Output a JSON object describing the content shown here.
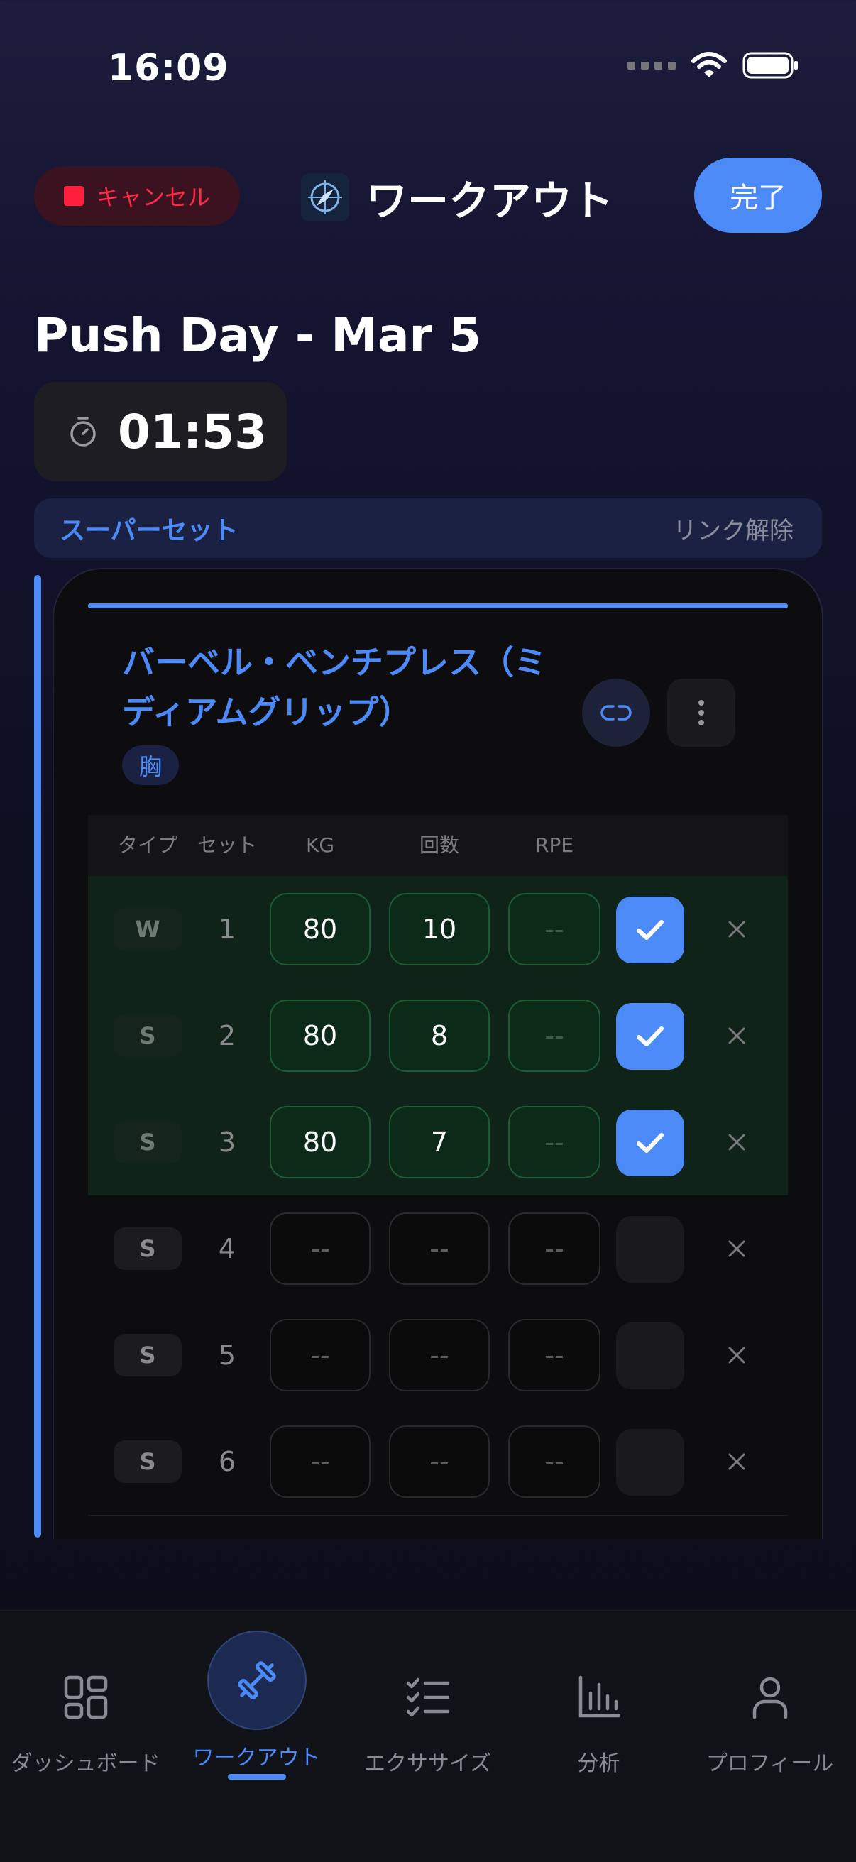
{
  "status_bar": {
    "time": "16:09"
  },
  "header": {
    "cancel_label": "キャンセル",
    "title": "ワークアウト",
    "done_label": "完了"
  },
  "workout": {
    "name": "Push Day - Mar 5",
    "timer": "01:53"
  },
  "superset": {
    "label": "スーパーセット",
    "unlink_label": "リンク解除"
  },
  "exercise": {
    "name": "バーベル・ベンチプレス（ミディアムグリップ）",
    "muscle_tag": "胸",
    "columns": {
      "type": "タイプ",
      "set": "セット",
      "kg": "KG",
      "reps": "回数",
      "rpe": "RPE"
    },
    "sets": [
      {
        "type": "W",
        "set": "1",
        "kg": "80",
        "reps": "10",
        "rpe": "--",
        "completed": true
      },
      {
        "type": "S",
        "set": "2",
        "kg": "80",
        "reps": "8",
        "rpe": "--",
        "completed": true
      },
      {
        "type": "S",
        "set": "3",
        "kg": "80",
        "reps": "7",
        "rpe": "--",
        "completed": true
      },
      {
        "type": "S",
        "set": "4",
        "kg": "--",
        "reps": "--",
        "rpe": "--",
        "completed": false
      },
      {
        "type": "S",
        "set": "5",
        "kg": "--",
        "reps": "--",
        "rpe": "--",
        "completed": false
      },
      {
        "type": "S",
        "set": "6",
        "kg": "--",
        "reps": "--",
        "rpe": "--",
        "completed": false
      }
    ]
  },
  "tab_bar": {
    "items": [
      {
        "label": "ダッシュボード",
        "icon": "dashboard-icon"
      },
      {
        "label": "ワークアウト",
        "icon": "dumbbell-icon",
        "active": true
      },
      {
        "label": "エクササイズ",
        "icon": "checklist-icon"
      },
      {
        "label": "分析",
        "icon": "bar-chart-icon"
      },
      {
        "label": "プロフィール",
        "icon": "person-icon"
      }
    ]
  },
  "colors": {
    "accent": "#4c8af8",
    "cancel": "#ff2a45",
    "completed_row": "#0f2318"
  }
}
